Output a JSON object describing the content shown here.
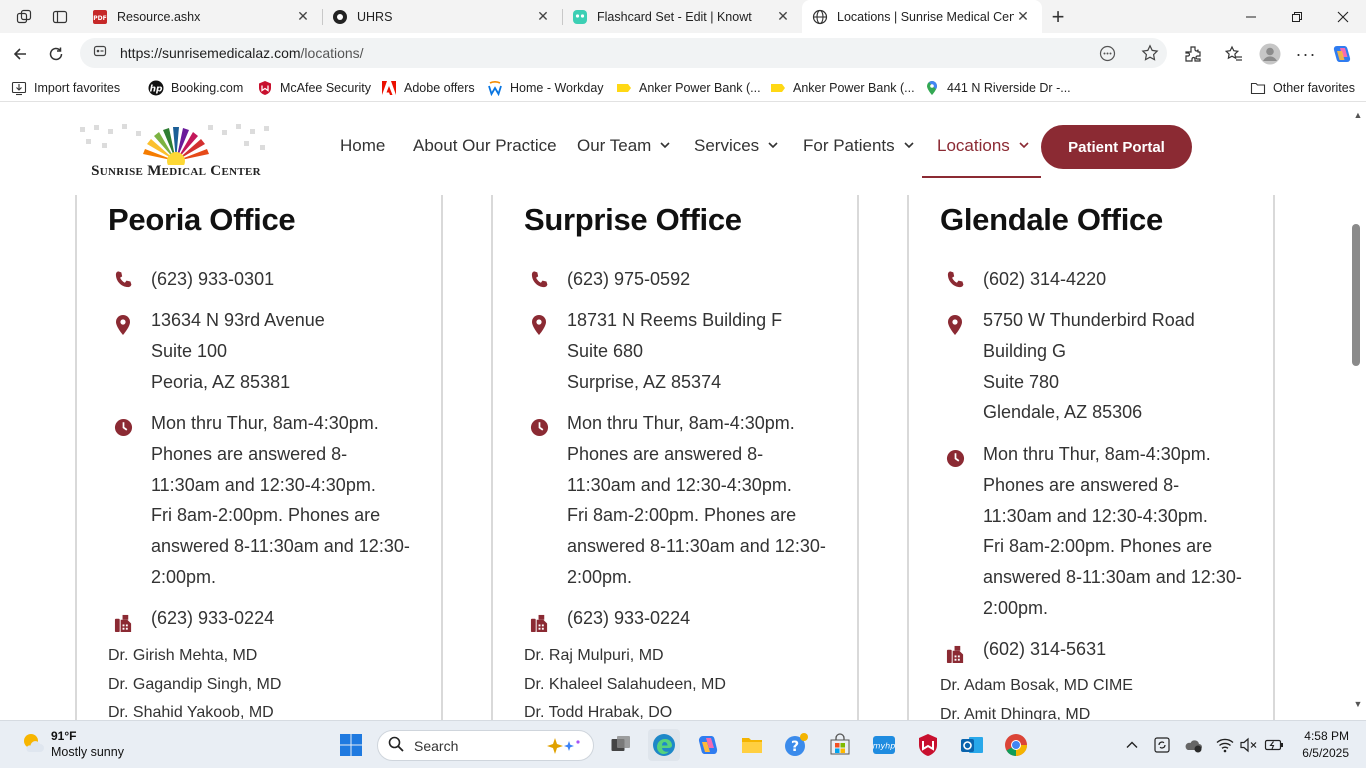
{
  "browser": {
    "tabs": [
      {
        "label": "Resource.ashx"
      },
      {
        "label": "UHRS"
      },
      {
        "label": "Flashcard Set - Edit | Knowt"
      },
      {
        "label": "Locations | Sunrise Medical Cente",
        "active": true
      }
    ],
    "url_host": "https://sunrisemedicalaz.com",
    "url_path": "/locations/",
    "favorites": [
      {
        "label": "Import favorites",
        "icon": "import-icon"
      },
      {
        "label": "Booking.com",
        "icon": "hp-icon"
      },
      {
        "label": "McAfee Security",
        "icon": "mcafee-icon"
      },
      {
        "label": "Adobe offers",
        "icon": "adobe-icon"
      },
      {
        "label": "Home - Workday",
        "icon": "workday-icon"
      },
      {
        "label": "Anker Power Bank (...",
        "icon": "amazon-tag-icon"
      },
      {
        "label": "Anker Power Bank (...",
        "icon": "amazon-tag-icon"
      },
      {
        "label": "441 N Riverside Dr -...",
        "icon": "maps-pin-icon"
      },
      {
        "label": "Other favorites",
        "icon": "folder-icon"
      }
    ]
  },
  "site": {
    "logo_text": "Sunrise Medical Center",
    "nav": [
      {
        "label": "Home",
        "has_menu": false
      },
      {
        "label": "About Our Practice",
        "has_menu": false
      },
      {
        "label": "Our Team",
        "has_menu": true
      },
      {
        "label": "Services",
        "has_menu": true
      },
      {
        "label": "For Patients",
        "has_menu": true
      },
      {
        "label": "Locations",
        "has_menu": true,
        "active": true
      }
    ],
    "portal_button": "Patient Portal",
    "accent_color": "#8b2a33"
  },
  "offices": [
    {
      "title": "Peoria Office",
      "phone": "(623) 933-0301",
      "address": [
        "13634 N 93rd Avenue",
        "Suite 100",
        "Peoria, AZ 85381"
      ],
      "hours": [
        "Mon thru Thur, 8am-4:30pm.",
        "Phones are answered 8-",
        "11:30am and 12:30-4:30pm.",
        "Fri 8am-2:00pm. Phones are",
        "answered 8-11:30am and 12:30-",
        "2:00pm."
      ],
      "fax": "(623) 933-0224",
      "doctors": [
        "Dr. Girish Mehta, MD",
        "Dr. Gagandip Singh, MD",
        "Dr. Shahid Yakoob, MD"
      ]
    },
    {
      "title": "Surprise Office",
      "phone": "(623) 975-0592",
      "address": [
        "18731 N Reems Building F",
        "Suite 680",
        "Surprise, AZ 85374"
      ],
      "hours": [
        "Mon thru Thur, 8am-4:30pm.",
        "Phones are answered 8-",
        "11:30am and 12:30-4:30pm.",
        "Fri 8am-2:00pm. Phones are",
        "answered 8-11:30am and 12:30-",
        "2:00pm."
      ],
      "fax": "(623) 933-0224",
      "doctors": [
        "Dr. Raj Mulpuri, MD",
        "Dr. Khaleel Salahudeen, MD",
        "Dr. Todd Hrabak, DO"
      ]
    },
    {
      "title": "Glendale Office",
      "phone": "(602) 314-4220",
      "address": [
        "5750 W Thunderbird Road",
        "Building G",
        "Suite 780",
        "Glendale, AZ 85306"
      ],
      "hours": [
        "Mon thru Thur, 8am-4:30pm.",
        "Phones are answered 8-",
        "11:30am and 12:30-4:30pm.",
        "Fri 8am-2:00pm. Phones are",
        "answered 8-11:30am and 12:30-",
        "2:00pm."
      ],
      "fax": "(602) 314-5631",
      "doctors": [
        "Dr. Adam Bosak, MD CIME",
        "Dr. Amit Dhingra, MD"
      ]
    }
  ],
  "taskbar": {
    "weather_temp": "91°F",
    "weather_desc": "Mostly sunny",
    "search_placeholder": "Search",
    "time": "4:58 PM",
    "date": "6/5/2025"
  }
}
